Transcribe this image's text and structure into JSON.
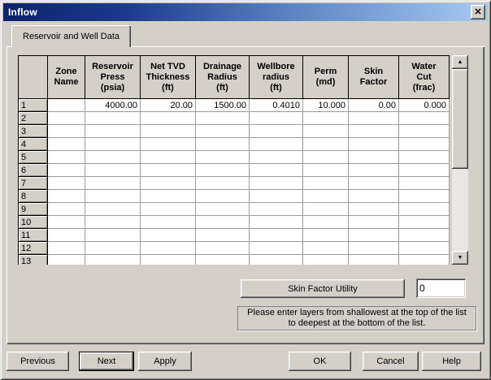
{
  "window": {
    "title": "Inflow"
  },
  "icons": {
    "close": "✕",
    "scroll_up": "▲",
    "scroll_down": "▼"
  },
  "tab": {
    "label": "Reservoir and Well Data"
  },
  "grid": {
    "columns": [
      "",
      "Zone\nName",
      "Reservoir\nPress\n(psia)",
      "Net TVD\nThickness\n(ft)",
      "Drainage\nRadius\n(ft)",
      "Wellbore\nradius\n(ft)",
      "Perm\n(md)",
      "Skin\nFactor",
      "Water\nCut\n(frac)"
    ],
    "rows": [
      {
        "num": "1",
        "cells": [
          "",
          "4000.00",
          "20.00",
          "1500.00",
          "0.4010",
          "10.000",
          "0.00",
          "0.000"
        ]
      },
      {
        "num": "2",
        "cells": [
          "",
          "",
          "",
          "",
          "",
          "",
          "",
          ""
        ]
      },
      {
        "num": "3",
        "cells": [
          "",
          "",
          "",
          "",
          "",
          "",
          "",
          ""
        ]
      },
      {
        "num": "4",
        "cells": [
          "",
          "",
          "",
          "",
          "",
          "",
          "",
          ""
        ]
      },
      {
        "num": "5",
        "cells": [
          "",
          "",
          "",
          "",
          "",
          "",
          "",
          ""
        ]
      },
      {
        "num": "6",
        "cells": [
          "",
          "",
          "",
          "",
          "",
          "",
          "",
          ""
        ]
      },
      {
        "num": "7",
        "cells": [
          "",
          "",
          "",
          "",
          "",
          "",
          "",
          ""
        ]
      },
      {
        "num": "8",
        "cells": [
          "",
          "",
          "",
          "",
          "",
          "",
          "",
          ""
        ]
      },
      {
        "num": "9",
        "cells": [
          "",
          "",
          "",
          "",
          "",
          "",
          "",
          ""
        ]
      },
      {
        "num": "10",
        "cells": [
          "",
          "",
          "",
          "",
          "",
          "",
          "",
          ""
        ]
      },
      {
        "num": "11",
        "cells": [
          "",
          "",
          "",
          "",
          "",
          "",
          "",
          ""
        ]
      },
      {
        "num": "12",
        "cells": [
          "",
          "",
          "",
          "",
          "",
          "",
          "",
          ""
        ]
      },
      {
        "num": "13",
        "cells": [
          "",
          "",
          "",
          "",
          "",
          "",
          "",
          ""
        ]
      }
    ]
  },
  "utility": {
    "button_label": "Skin Factor Utility",
    "input_value": "0"
  },
  "note": {
    "line1": "Please enter layers from shallowest at the top of the list",
    "line2": "to deepest at the bottom of the list."
  },
  "footer": {
    "previous": "Previous",
    "next": "Next",
    "apply": "Apply",
    "ok": "OK",
    "cancel": "Cancel",
    "help": "Help"
  },
  "colors": {
    "dialog_bg": "#d4d0c8",
    "titlebar_from": "#0b236b",
    "titlebar_to": "#a6caf0",
    "grid_line": "#9c9c9c"
  }
}
